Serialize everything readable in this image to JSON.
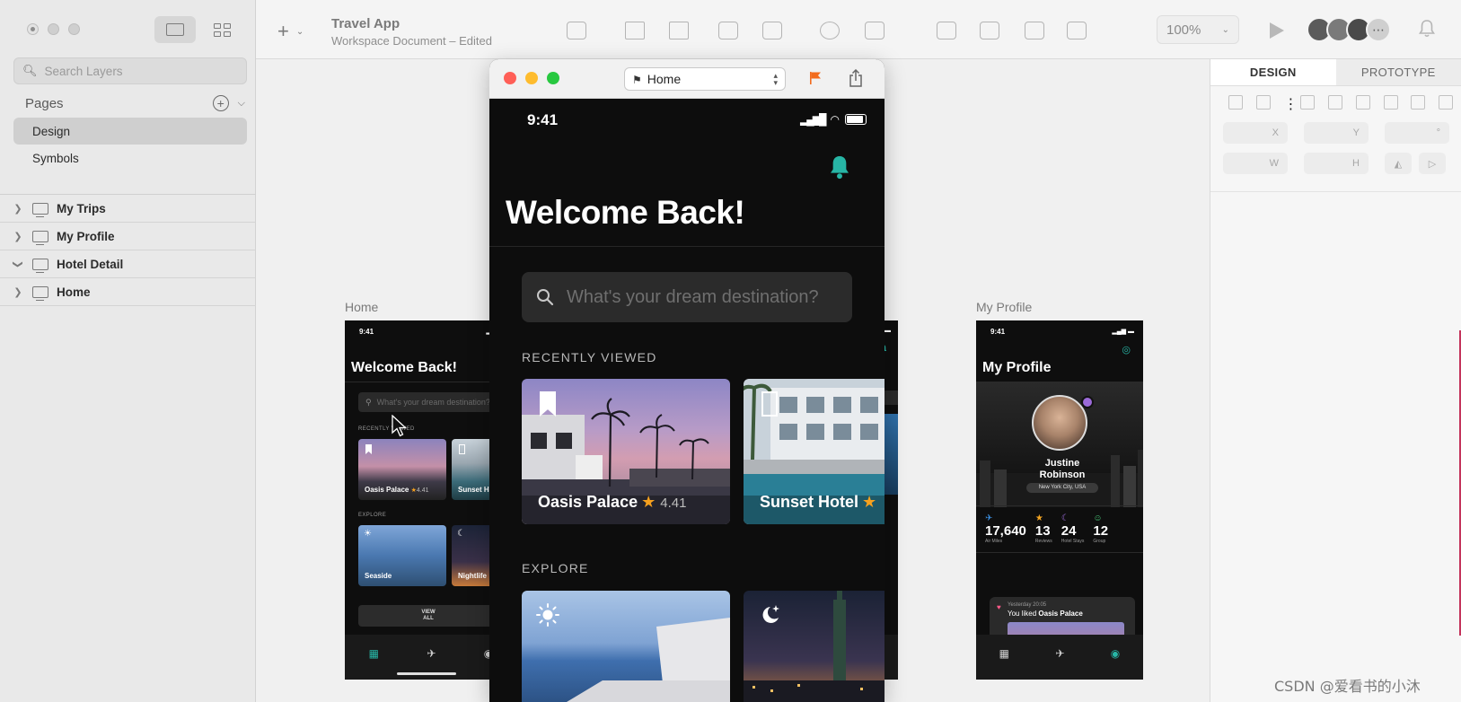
{
  "sidebar": {
    "search_placeholder": "Search Layers",
    "pages_label": "Pages",
    "pages": [
      {
        "label": "Design",
        "selected": true
      },
      {
        "label": "Symbols",
        "selected": false
      }
    ],
    "layers": [
      {
        "label": "My Trips",
        "expanded": false
      },
      {
        "label": "My Profile",
        "expanded": false
      },
      {
        "label": "Hotel Detail",
        "expanded": true
      },
      {
        "label": "Home",
        "expanded": false
      }
    ]
  },
  "toolbar": {
    "doc_title": "Travel App",
    "doc_subtitle": "Workspace Document – Edited",
    "zoom": "100%"
  },
  "inspector": {
    "tabs": [
      "DESIGN",
      "PROTOTYPE"
    ],
    "fields": {
      "x": "X",
      "y": "Y",
      "rotation": "°",
      "w": "W",
      "h": "H"
    }
  },
  "canvas": {
    "artboard_home": {
      "label": "Home",
      "time": "9:41",
      "title": "Welcome Back!",
      "search_placeholder": "What's your dream destination?",
      "recent_label": "RECENTLY VIEWED",
      "cards": [
        {
          "name": "Oasis Palace",
          "rating": "4.41"
        },
        {
          "name": "Sunset Hotel"
        }
      ],
      "explore_label": "EXPLORE",
      "explore": [
        {
          "name": "Seaside"
        },
        {
          "name": "Nightlife"
        }
      ],
      "view_all": "VIEW ALL"
    },
    "artboard_profile": {
      "label": "My Profile",
      "time": "9:41",
      "title": "My Profile",
      "name": "Justine Robinson",
      "location": "New York City, USA",
      "stats": [
        {
          "value": "17,640",
          "label": "Air Miles",
          "color": "#3b8fe0"
        },
        {
          "value": "13",
          "label": "Reviews",
          "color": "#f5a623"
        },
        {
          "value": "24",
          "label": "Hotel Stays",
          "color": "#9b6ad8"
        },
        {
          "value": "12",
          "label": "Group",
          "color": "#4cd07d"
        }
      ],
      "notif_time": "Yesterday 20:05",
      "notif_text_prefix": "You liked ",
      "notif_text_bold": "Oasis Palace"
    }
  },
  "prototype": {
    "screen_select": "Home",
    "time": "9:41",
    "title": "Welcome Back!",
    "search_placeholder": "What's your dream destination?",
    "recent_label": "RECENTLY VIEWED",
    "cards": [
      {
        "name": "Oasis Palace",
        "star": "★",
        "rating": "4.41"
      },
      {
        "name": "Sunset Hotel",
        "star": "★"
      }
    ],
    "explore_label": "EXPLORE"
  },
  "colors": {
    "accent": "#27b5a5",
    "star": "#f7a11e",
    "flag": "#f26b1d"
  },
  "watermark": "CSDN @爱看书的小沐"
}
